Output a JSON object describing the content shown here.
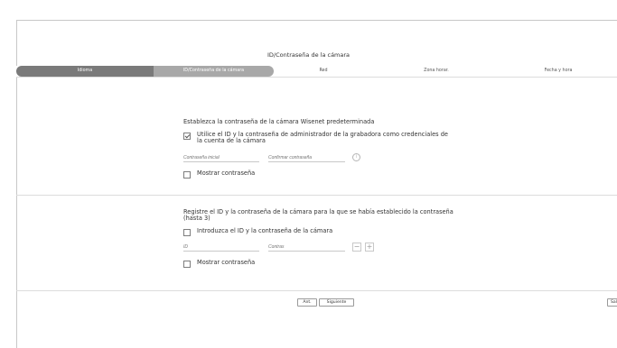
{
  "header": {
    "title": "ID/Contraseña de la cámara"
  },
  "stepper": {
    "steps": [
      {
        "label": "Idioma",
        "state": "done"
      },
      {
        "label": "ID/Contraseña de la cámara",
        "state": "current"
      },
      {
        "label": "Red",
        "state": "pending"
      },
      {
        "label": "Zona horar.",
        "state": "pending"
      },
      {
        "label": "Fecha y hora",
        "state": "pending"
      }
    ]
  },
  "default_password": {
    "heading": "Establezca la contraseña de la cámara Wisenet predeterminada",
    "use_admin_checkbox": {
      "label_line1": "Utilice el ID y la contraseña de administrador de la grabadora como credenciales de",
      "label_line2": "la cuenta de la cámara",
      "checked": true
    },
    "initial_password_placeholder": "Contraseña inicial",
    "confirm_password_placeholder": "Confirmar contraseña",
    "info_icon": "info-icon",
    "show_password_label": "Mostrar contraseña"
  },
  "camera_credentials": {
    "heading_line1": "Registre el ID y la contraseña de la cámara para la que se había establecido la contraseña",
    "heading_line2": "(hasta 3)",
    "enter_id_checkbox": {
      "label": "Introduzca el ID y la contraseña de la cámara",
      "checked": false
    },
    "id_placeholder": "ID",
    "password_placeholder": "Contras",
    "minus_label": "−",
    "plus_label": "+",
    "show_password_label": "Mostrar contraseña"
  },
  "footer": {
    "prev_label": "Ant.",
    "next_label": "Siguiente",
    "exit_label": "Sal"
  }
}
